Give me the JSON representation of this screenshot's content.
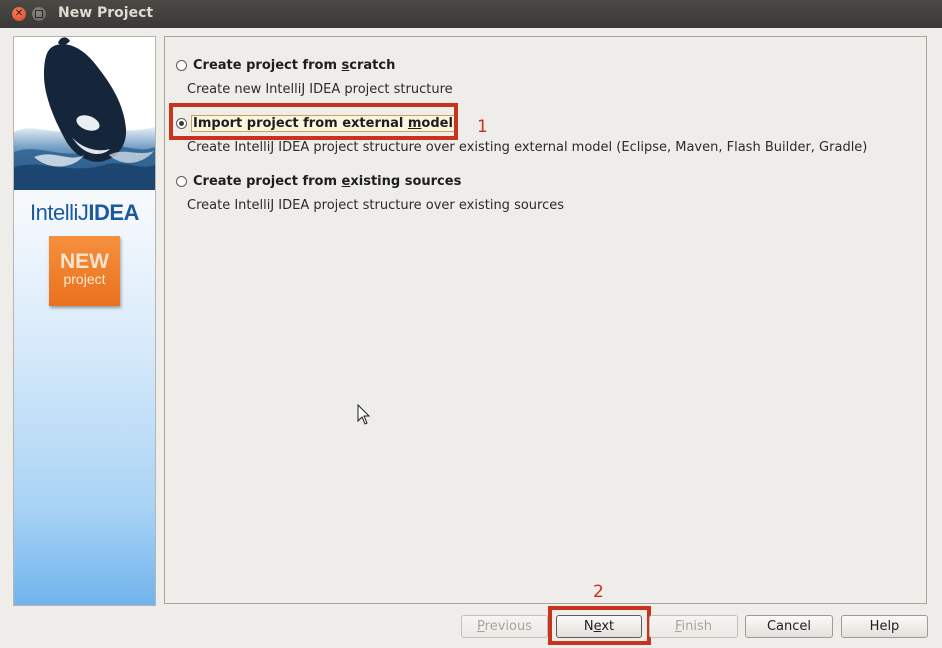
{
  "window": {
    "title": "New Project"
  },
  "sidebar": {
    "brand_prefix": "IntelliJ",
    "brand_suffix": "IDEA",
    "badge_big": "NEW",
    "badge_small": "project"
  },
  "options": [
    {
      "label_pre": "Create project from ",
      "label_mnemonic": "s",
      "label_post": "cratch",
      "description": "Create new IntelliJ IDEA project structure",
      "selected": false
    },
    {
      "label_pre": "Import project from external ",
      "label_mnemonic": "m",
      "label_post": "odel",
      "description": "Create IntelliJ IDEA project structure over existing external model (Eclipse, Maven, Flash Builder, Gradle)",
      "selected": true
    },
    {
      "label_pre": "Create project from ",
      "label_mnemonic": "e",
      "label_post": "xisting sources",
      "description": "Create IntelliJ IDEA project structure over existing sources",
      "selected": false
    }
  ],
  "annotations": {
    "one": "1",
    "two": "2",
    "color": "#c8321e"
  },
  "buttons": {
    "previous": {
      "mnemonic": "P",
      "rest": "revious",
      "enabled": false
    },
    "next": {
      "pre": "N",
      "mnemonic": "e",
      "rest": "xt",
      "enabled": true
    },
    "finish": {
      "mnemonic": "F",
      "rest": "inish",
      "enabled": false
    },
    "cancel": "Cancel",
    "help": "Help"
  }
}
